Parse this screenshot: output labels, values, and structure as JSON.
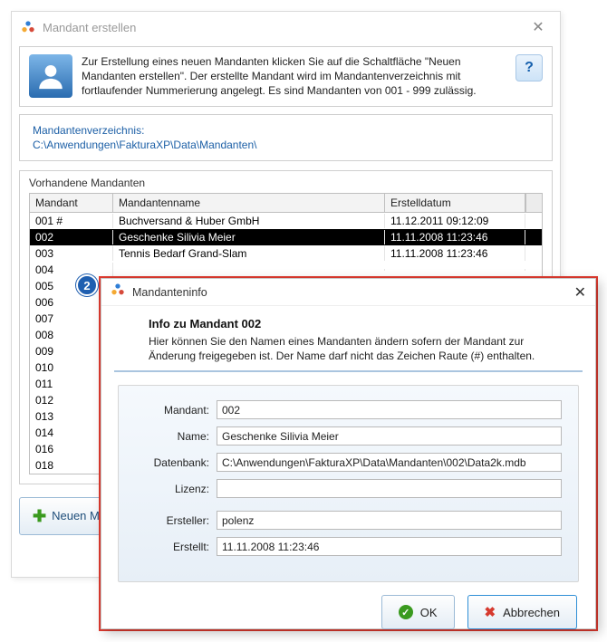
{
  "main": {
    "title": "Mandant erstellen",
    "intro": "Zur Erstellung eines neuen Mandanten klicken Sie auf die Schaltfläche \"Neuen Mandanten erstellen\". Der erstellte Mandant wird im Mandantenverzeichnis  mit fortlaufender Nummerierung angelegt. Es sind Mandanten von 001 - 999 zulässig.",
    "path_label": "Mandantenverzeichnis:",
    "path_value": "C:\\Anwendungen\\FakturaXP\\Data\\Mandanten\\",
    "table_caption": "Vorhandene Mandanten",
    "columns": {
      "mandant": "Mandant",
      "name": "Mandantenname",
      "date": "Erstelldatum"
    },
    "rows": [
      {
        "mandant": "001 #",
        "name": "Buchversand & Huber GmbH",
        "date": "11.12.2011 09:12:09",
        "selected": false
      },
      {
        "mandant": "002",
        "name": "Geschenke Silivia Meier",
        "date": "11.11.2008 11:23:46",
        "selected": true
      },
      {
        "mandant": "003",
        "name": "Tennis Bedarf Grand-Slam",
        "date": "11.11.2008 11:23:46",
        "selected": false
      },
      {
        "mandant": "004",
        "name": "",
        "date": "",
        "selected": false
      },
      {
        "mandant": "005",
        "name": "",
        "date": "",
        "selected": false
      },
      {
        "mandant": "006",
        "name": "",
        "date": "",
        "selected": false
      },
      {
        "mandant": "007",
        "name": "",
        "date": "",
        "selected": false
      },
      {
        "mandant": "008",
        "name": "",
        "date": "",
        "selected": false
      },
      {
        "mandant": "009",
        "name": "",
        "date": "",
        "selected": false
      },
      {
        "mandant": "010",
        "name": "",
        "date": "",
        "selected": false
      },
      {
        "mandant": "011",
        "name": "",
        "date": "",
        "selected": false
      },
      {
        "mandant": "012",
        "name": "",
        "date": "",
        "selected": false
      },
      {
        "mandant": "013",
        "name": "",
        "date": "",
        "selected": false
      },
      {
        "mandant": "014",
        "name": "",
        "date": "",
        "selected": false
      },
      {
        "mandant": "016",
        "name": "",
        "date": "",
        "selected": false
      },
      {
        "mandant": "018",
        "name": "",
        "date": "",
        "selected": false
      }
    ],
    "new_button": "Neuen M"
  },
  "dialog": {
    "title": "Mandanteninfo",
    "heading": "Info zu Mandant  002",
    "sub": "Hier können Sie den Namen eines Mandanten ändern sofern der Mandant zur Änderung freigegeben ist. Der Name darf nicht das Zeichen Raute (#) enthalten.",
    "labels": {
      "mandant": "Mandant:",
      "name": "Name:",
      "datenbank": "Datenbank:",
      "lizenz": "Lizenz:",
      "ersteller": "Ersteller:",
      "erstellt": "Erstellt:"
    },
    "values": {
      "mandant": "002",
      "name": "Geschenke Silivia Meier",
      "datenbank": "C:\\Anwendungen\\FakturaXP\\Data\\Mandanten\\002\\Data2k.mdb",
      "lizenz": "",
      "ersteller": "polenz",
      "erstellt": "11.11.2008 11:23:46"
    },
    "ok": "OK",
    "cancel": "Abbrechen"
  },
  "callout": "2"
}
